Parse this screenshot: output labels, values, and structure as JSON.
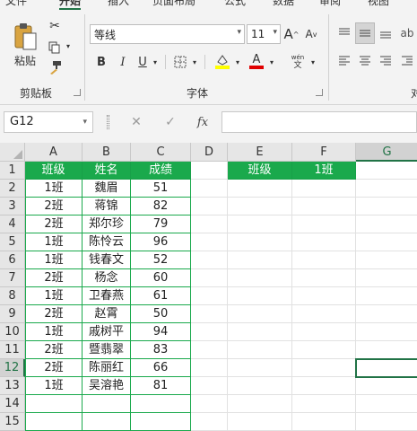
{
  "ribbon": {
    "tabs": [
      "文件",
      "开始",
      "插入",
      "页面布局",
      "公式",
      "数据",
      "审阅",
      "视图"
    ],
    "clipboard": {
      "paste_label": "粘贴",
      "group_label": "剪贴板"
    },
    "font": {
      "name": "等线",
      "size": "11",
      "bold": "B",
      "italic": "I",
      "underline": "U",
      "grow": "A",
      "shrink": "A",
      "pinyin_top": "wén",
      "pinyin_bottom": "文",
      "group_label": "字体"
    },
    "align": {
      "group_label": "对"
    }
  },
  "formula_bar": {
    "name_box": "G12",
    "fx": "fx",
    "cancel": "✕",
    "enter": "✓",
    "content": ""
  },
  "columns": [
    "A",
    "B",
    "C",
    "D",
    "E",
    "F",
    "G"
  ],
  "rows": [
    "1",
    "2",
    "3",
    "4",
    "5",
    "6",
    "7",
    "8",
    "9",
    "10",
    "11",
    "12",
    "13",
    "14",
    "15"
  ],
  "table": {
    "headers": [
      "班级",
      "姓名",
      "成绩"
    ],
    "rows": [
      [
        "1班",
        "魏眉",
        "51"
      ],
      [
        "2班",
        "蒋锦",
        "82"
      ],
      [
        "2班",
        "郑尔珍",
        "79"
      ],
      [
        "1班",
        "陈怜云",
        "96"
      ],
      [
        "1班",
        "钱春文",
        "52"
      ],
      [
        "2班",
        "杨念",
        "60"
      ],
      [
        "1班",
        "卫春燕",
        "61"
      ],
      [
        "2班",
        "赵霄",
        "50"
      ],
      [
        "1班",
        "戚树平",
        "94"
      ],
      [
        "2班",
        "暨翡翠",
        "83"
      ],
      [
        "2班",
        "陈丽红",
        "66"
      ],
      [
        "1班",
        "吴溶艳",
        "81"
      ]
    ]
  },
  "criteria": {
    "label": "班级",
    "value": "1班"
  },
  "colors": {
    "accent": "#217346",
    "header_fill": "#1aa94c"
  }
}
